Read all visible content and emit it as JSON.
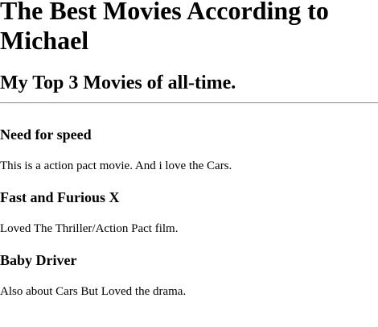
{
  "page": {
    "title": "The Best Movies According to Michael",
    "subtitle": "My Top 3 Movies of all-time."
  },
  "movies": [
    {
      "name": "Need for speed",
      "description": "This is a action pact movie. And i love the Cars."
    },
    {
      "name": "Fast and Furious X",
      "description": "Loved The Thriller/Action Pact film."
    },
    {
      "name": "Baby Driver",
      "description": "Also about Cars But Loved the drama."
    }
  ]
}
